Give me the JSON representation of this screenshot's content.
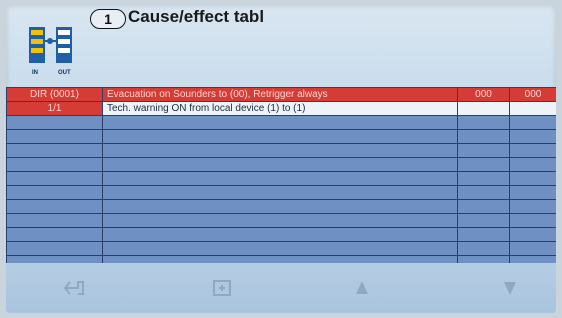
{
  "header": {
    "badge": "1",
    "title": "Cause/effect tabl",
    "icon_labels": {
      "in": "IN",
      "out": "OUT"
    }
  },
  "table": {
    "rows": [
      {
        "c1": "DIR (0001)",
        "c2": "Evacuation on Sounders to (00), Retrigger always",
        "c3": "000",
        "c4": "000"
      },
      {
        "c1": "1/1",
        "c2": "Tech. warning ON from local device (1) to (1)",
        "c3": "",
        "c4": ""
      }
    ],
    "empty_rows": 12
  },
  "footer": {
    "buttons": [
      "back-icon",
      "edit-icon",
      "up-arrow-icon",
      "down-arrow-icon"
    ]
  },
  "colors": {
    "row_red": "#d63c36",
    "grid_blue": "#6f90c2",
    "selected_white": "#eef3f8"
  }
}
